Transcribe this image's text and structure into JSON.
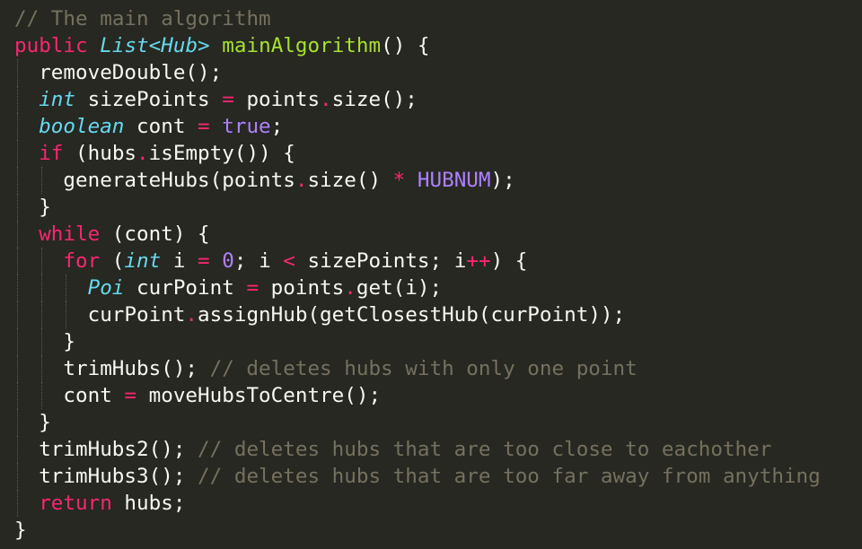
{
  "theme": {
    "background": "#272822",
    "foreground": "#f8f8f2",
    "comment": "#75715e",
    "keyword": "#f92672",
    "storage_type": "#66d9ef",
    "function_name": "#a6e22e",
    "constant": "#ae81ff"
  },
  "code": {
    "lines": [
      {
        "indent": 0,
        "tokens": [
          {
            "t": "comment",
            "v": "// The main algorithm"
          }
        ]
      },
      {
        "indent": 0,
        "tokens": [
          {
            "t": "keyword",
            "v": "public"
          },
          {
            "t": "plain",
            "v": " "
          },
          {
            "t": "storage",
            "v": "List<Hub>"
          },
          {
            "t": "plain",
            "v": " "
          },
          {
            "t": "func",
            "v": "mainAlgorithm"
          },
          {
            "t": "plain",
            "v": "() {"
          }
        ]
      },
      {
        "indent": 1,
        "tokens": [
          {
            "t": "plain",
            "v": "removeDouble();"
          }
        ]
      },
      {
        "indent": 1,
        "tokens": [
          {
            "t": "storage",
            "v": "int"
          },
          {
            "t": "plain",
            "v": " sizePoints "
          },
          {
            "t": "op",
            "v": "="
          },
          {
            "t": "plain",
            "v": " points"
          },
          {
            "t": "op",
            "v": "."
          },
          {
            "t": "plain",
            "v": "size();"
          }
        ]
      },
      {
        "indent": 1,
        "tokens": [
          {
            "t": "storage",
            "v": "boolean"
          },
          {
            "t": "plain",
            "v": " cont "
          },
          {
            "t": "op",
            "v": "="
          },
          {
            "t": "plain",
            "v": " "
          },
          {
            "t": "const",
            "v": "true"
          },
          {
            "t": "plain",
            "v": ";"
          }
        ]
      },
      {
        "indent": 1,
        "tokens": [
          {
            "t": "keyword",
            "v": "if"
          },
          {
            "t": "plain",
            "v": " (hubs"
          },
          {
            "t": "op",
            "v": "."
          },
          {
            "t": "plain",
            "v": "isEmpty()) {"
          }
        ]
      },
      {
        "indent": 2,
        "tokens": [
          {
            "t": "plain",
            "v": "generateHubs(points"
          },
          {
            "t": "op",
            "v": "."
          },
          {
            "t": "plain",
            "v": "size() "
          },
          {
            "t": "op",
            "v": "*"
          },
          {
            "t": "plain",
            "v": " "
          },
          {
            "t": "const",
            "v": "HUBNUM"
          },
          {
            "t": "plain",
            "v": ");"
          }
        ]
      },
      {
        "indent": 1,
        "tokens": [
          {
            "t": "plain",
            "v": "}"
          }
        ]
      },
      {
        "indent": 1,
        "tokens": [
          {
            "t": "keyword",
            "v": "while"
          },
          {
            "t": "plain",
            "v": " (cont) {"
          }
        ]
      },
      {
        "indent": 2,
        "tokens": [
          {
            "t": "keyword",
            "v": "for"
          },
          {
            "t": "plain",
            "v": " ("
          },
          {
            "t": "storage",
            "v": "int"
          },
          {
            "t": "plain",
            "v": " i "
          },
          {
            "t": "op",
            "v": "="
          },
          {
            "t": "plain",
            "v": " "
          },
          {
            "t": "const",
            "v": "0"
          },
          {
            "t": "plain",
            "v": "; i "
          },
          {
            "t": "op",
            "v": "<"
          },
          {
            "t": "plain",
            "v": " sizePoints; i"
          },
          {
            "t": "op",
            "v": "++"
          },
          {
            "t": "plain",
            "v": ") {"
          }
        ]
      },
      {
        "indent": 3,
        "tokens": [
          {
            "t": "storage",
            "v": "Poi"
          },
          {
            "t": "plain",
            "v": " curPoint "
          },
          {
            "t": "op",
            "v": "="
          },
          {
            "t": "plain",
            "v": " points"
          },
          {
            "t": "op",
            "v": "."
          },
          {
            "t": "plain",
            "v": "get(i);"
          }
        ]
      },
      {
        "indent": 3,
        "tokens": [
          {
            "t": "plain",
            "v": "curPoint"
          },
          {
            "t": "op",
            "v": "."
          },
          {
            "t": "plain",
            "v": "assignHub(getClosestHub(curPoint));"
          }
        ]
      },
      {
        "indent": 2,
        "tokens": [
          {
            "t": "plain",
            "v": "}"
          }
        ]
      },
      {
        "indent": 2,
        "tokens": [
          {
            "t": "plain",
            "v": "trimHubs(); "
          },
          {
            "t": "comment",
            "v": "// deletes hubs with only one point"
          }
        ]
      },
      {
        "indent": 2,
        "tokens": [
          {
            "t": "plain",
            "v": "cont "
          },
          {
            "t": "op",
            "v": "="
          },
          {
            "t": "plain",
            "v": " moveHubsToCentre();"
          }
        ]
      },
      {
        "indent": 1,
        "tokens": [
          {
            "t": "plain",
            "v": "}"
          }
        ]
      },
      {
        "indent": 1,
        "tokens": [
          {
            "t": "plain",
            "v": "trimHubs2(); "
          },
          {
            "t": "comment",
            "v": "// deletes hubs that are too close to eachother"
          }
        ]
      },
      {
        "indent": 1,
        "tokens": [
          {
            "t": "plain",
            "v": "trimHubs3(); "
          },
          {
            "t": "comment",
            "v": "// deletes hubs that are too far away from anything"
          }
        ]
      },
      {
        "indent": 1,
        "tokens": [
          {
            "t": "keyword",
            "v": "return"
          },
          {
            "t": "plain",
            "v": " hubs;"
          }
        ]
      },
      {
        "indent": 0,
        "tokens": [
          {
            "t": "plain",
            "v": "}"
          }
        ]
      }
    ]
  }
}
